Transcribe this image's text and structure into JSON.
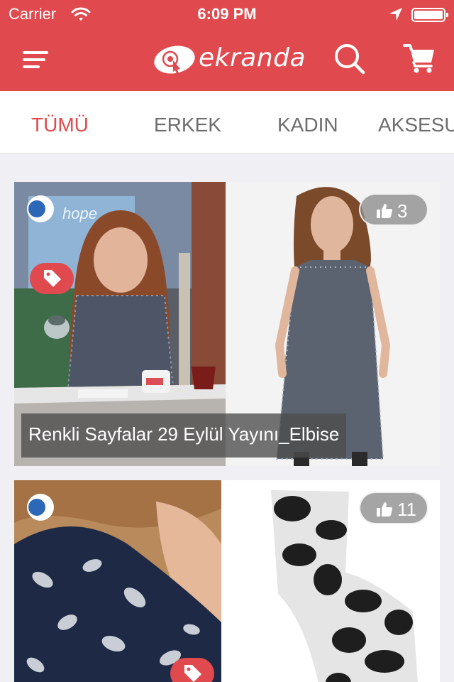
{
  "status_bar": {
    "carrier": "Carrier",
    "time": "6:09 PM"
  },
  "header": {
    "logo_text": "ekranda",
    "menu_icon": "menu-icon",
    "search_icon": "search-icon",
    "cart_icon": "cart-icon"
  },
  "tabs": [
    {
      "label": "TÜMÜ",
      "active": true
    },
    {
      "label": "ERKEK",
      "active": false
    },
    {
      "label": "KADIN",
      "active": false
    },
    {
      "label": "AKSESUAR",
      "active": false
    }
  ],
  "products": [
    {
      "likes": "3",
      "caption": "Renkli Sayfalar 29 Eylül Yayını_Elbise",
      "channel_logo_text": "hope"
    },
    {
      "likes": "11",
      "caption": ""
    }
  ],
  "colors": {
    "brand": "#e04a4f",
    "background": "#efeff4",
    "tab_inactive": "#6d6d6d"
  }
}
